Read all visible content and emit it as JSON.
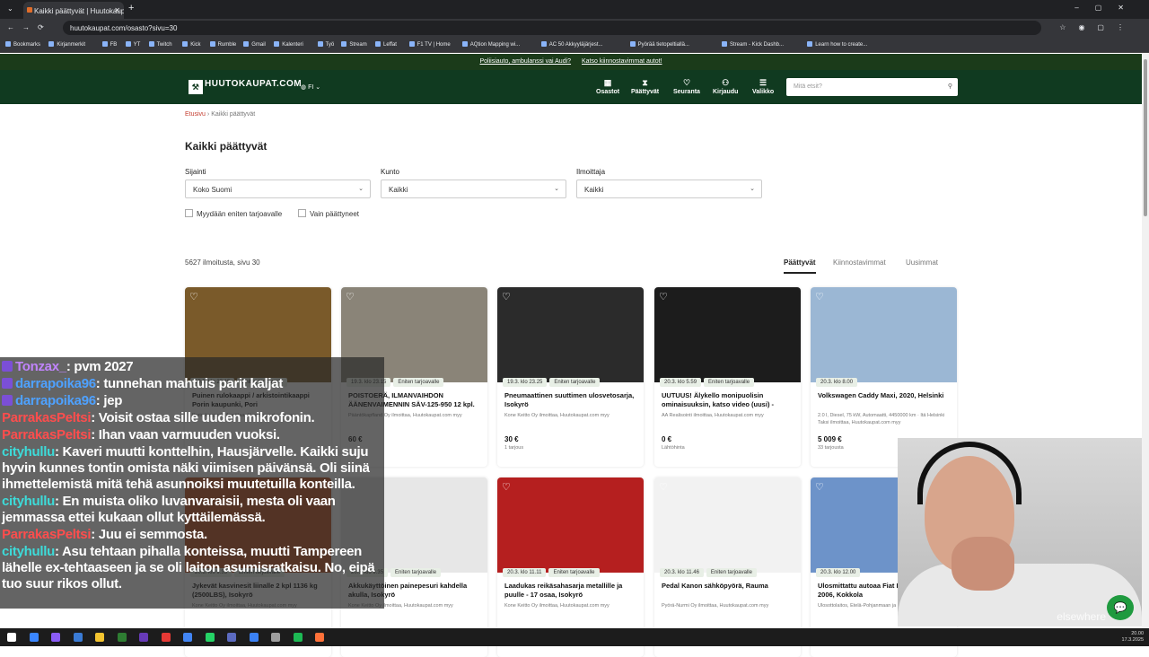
{
  "browser": {
    "tab_title": "Kaikki päättyvät | Huutokaupat",
    "url": "huutokaupat.com/osasto?sivu=30",
    "bookmarks": [
      "Bookmarks",
      "Kirjanmerkit",
      "FB",
      "YT",
      "Twitch",
      "Kick",
      "Rumble",
      "Gmail",
      "Kalenteri",
      "Työ",
      "Stream",
      "Leffat",
      "F1 TV | Home",
      "AQtion Mapping wi...",
      "AC 50 Akkyyläjärjest...",
      "Pyörää tietopeltiallä...",
      "Stream - Kick Dashb...",
      "Learn how to create..."
    ]
  },
  "promo": {
    "link1": "Poliisiauto, ambulanssi vai Audi?",
    "link2": "Katso kiinnostavimmat autot!"
  },
  "header": {
    "logo": "HUUTOKAUPAT.COM",
    "lang": "FI",
    "nav": [
      {
        "icon": "▦",
        "label": "Osastot"
      },
      {
        "icon": "⧗",
        "label": "Päättyvät"
      },
      {
        "icon": "♡",
        "label": "Seuranta"
      },
      {
        "icon": "⚇",
        "label": "Kirjaudu"
      },
      {
        "icon": "☰",
        "label": "Valikko"
      }
    ],
    "search_placeholder": "Mitä etsit?"
  },
  "breadcrumb": {
    "home": "Etusivu",
    "current": "Kaikki päättyvät"
  },
  "title": "Kaikki päättyvät",
  "filters": {
    "location_label": "Sijainti",
    "location_value": "Koko Suomi",
    "municipality_label": "Kunto",
    "municipality_value": "Kaikki",
    "seller_label": "Ilmoittaja",
    "seller_value": "Kaikki",
    "check1": "Myydään eniten tarjoavalle",
    "check2": "Vain päättyneet"
  },
  "results": {
    "count": "5627 ilmoitusta, sivu 30",
    "sort_tabs": [
      "Päättyvät",
      "Kiinnostavimmat",
      "Uusimmat"
    ]
  },
  "cards": [
    {
      "time": "19.3. klo 23.15",
      "badge": "Eniten tarjoavalle",
      "title": "Puinen rulokaappi / arkistointikaappi Porin kaupunki, Pori",
      "meta": "Porin kaupunki ilmoittaa, Huutokaupat.com myy",
      "price": "",
      "offers": "",
      "color": "#7a5a2a"
    },
    {
      "time": "19.3. klo 23.15",
      "badge": "Eniten tarjoavalle",
      "title": "POISTOERÄ, ILMANVAIHDON ÄÄNENVAIMENNIN SÄV-125-950 12 kpl. (RDXZ-37-1-1), Turku",
      "meta": "Pääntökapfland Oy ilmoittaa, Huutokaupat.com myy",
      "price": "60 €",
      "offers": "",
      "color": "#8a8478"
    },
    {
      "time": "19.3. klo 23.25",
      "badge": "Eniten tarjoavalle",
      "title": "Pneumaattinen suuttimen ulosvetosarja, Isokyrö",
      "meta": "Kone Keitto Oy ilmoittaa, Huutokaupat.com myy",
      "price": "30 €",
      "offers": "1 tarjous",
      "color": "#2b2b2b"
    },
    {
      "time": "20.3. klo 5.59",
      "badge": "Eniten tarjoavalle",
      "title": "UUTUUS! Älykello monipuolisin ominaisuuksin, katso video (uusi) - Elektroniikka (1379), Salo",
      "meta": "AA Realisointi ilmoittaa, Huutokaupat.com myy",
      "price": "0 €",
      "offers": "Lähtöhinta",
      "color": "#1c1c1c"
    },
    {
      "time": "20.3. klo 8.00",
      "badge": "",
      "title": "Volkswagen Caddy Maxi, 2020, Helsinki",
      "meta": "2.0 l, Diesel, 75 kW, Automaatti, 4450000 km · Itä Helsinki Taksi ilmoittaa, Huutokaupat.com myy",
      "price": "5 009 €",
      "offers": "33 tarjousta",
      "color": "#9bb7d4"
    },
    {
      "time": "20.3. klo 9.35",
      "badge": "Eniten tarjoavalle",
      "title": "Jykevät kasvinesit liinalle 2 kpl 1136 kg (2500LBS), Isokyrö",
      "meta": "Kone Keitto Oy ilmoittaa, Huutokaupat.com myy",
      "price": "",
      "offers": "",
      "color": "#c2501f"
    },
    {
      "time": "20.3. klo 9.35",
      "badge": "Eniten tarjoavalle",
      "title": "Akkukäyttöinen painepesuri kahdella akulla, Isokyrö",
      "meta": "Kone Keitto Oy ilmoittaa, Huutokaupat.com myy",
      "price": "",
      "offers": "",
      "color": "#e7e7e7"
    },
    {
      "time": "20.3. klo 11.11",
      "badge": "Eniten tarjoavalle",
      "title": "Laadukas reikäsahasarja metallille ja puulle - 17 osaa, Isokyrö",
      "meta": "Kone Keitto Oy ilmoittaa, Huutokaupat.com myy",
      "price": "",
      "offers": "",
      "color": "#b51f1f"
    },
    {
      "time": "20.3. klo 11.46",
      "badge": "Eniten tarjoavalle",
      "title": "Pedal Kanon sähköpyörä, Rauma",
      "meta": "Pyörä-Nurmi Oy ilmoittaa, Huutokaupat.com myy",
      "price": "",
      "offers": "",
      "color": "#f2f2f2"
    },
    {
      "time": "20.3. klo 12.00",
      "badge": "",
      "title": "Ulosmittattu autoaa Fiat Ducato, vm. 2006, Kokkola",
      "meta": "Ulosottolaitos, Etelä-Pohjanmaan ja Pohjanmaan",
      "price": "",
      "offers": "",
      "color": "#6d93c9"
    }
  ],
  "chat": [
    {
      "user": "Tonzax_",
      "color": "#c084fc",
      "text": ": pvm 2027",
      "icon": true
    },
    {
      "user": "darrapoika96",
      "color": "#4ea1ff",
      "text": ": tunnehan mahtuis parit kaljat",
      "icon": true
    },
    {
      "user": "darrapoika96",
      "color": "#4ea1ff",
      "text": ": jep",
      "icon": true
    },
    {
      "user": "ParrakasPeltsi",
      "color": "#ff4d4d",
      "text": ": Voisit ostaa sille uuden mikrofonin.",
      "icon": false
    },
    {
      "user": "ParrakasPeltsi",
      "color": "#ff4d4d",
      "text": ": Ihan vaan varmuuden vuoksi.",
      "icon": false
    },
    {
      "user": "cityhullu",
      "color": "#3ddbd9",
      "text": ": Kaveri muutti konttelhin, Hausjärvelle. Kaikki suju hyvin kunnes tontin omista näki viimisen päivänsä. Oli siinä ihmettelemistä mitä tehä asunnoiksi muutetuilla konteilla.",
      "icon": false
    },
    {
      "user": "cityhullu",
      "color": "#3ddbd9",
      "text": ": En muista oliko luvanvaraisii, mesta oli vaan jemmassa ettei kukaan ollut kyttäilemässä.",
      "icon": false
    },
    {
      "user": "ParrakasPeltsi",
      "color": "#ff4d4d",
      "text": ": Juu ei semmosta.",
      "icon": false
    },
    {
      "user": "cityhullu",
      "color": "#3ddbd9",
      "text": ": Asu tehtaan pihalla konteissa, muutti Tampereen lähelle ex-tehtaaseen ja se oli laiton asumisratkaisu. No, eipä tuo suur rikos ollut.",
      "icon": false
    }
  ],
  "webcam": {
    "watermark": "elsewhere"
  },
  "taskbar": {
    "time": "20.00",
    "date": "17.3.2025"
  }
}
